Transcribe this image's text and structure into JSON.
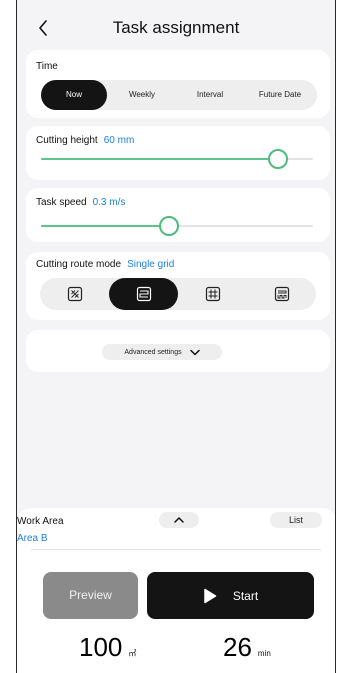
{
  "header": {
    "title": "Task assignment"
  },
  "time": {
    "label": "Time",
    "options": [
      "Now",
      "Weekly",
      "Interval",
      "Future Date"
    ],
    "selected": "Now"
  },
  "cutting_height": {
    "label": "Cutting height",
    "value": "60 mm",
    "level": 0.87
  },
  "task_speed": {
    "label": "Task speed",
    "value": "0.3 m/s",
    "level": 0.47
  },
  "route_mode": {
    "label": "Cutting route mode",
    "value": "Single grid",
    "options": [
      "random-route-icon",
      "single-grid-icon",
      "cross-grid-icon",
      "spiral-route-icon"
    ],
    "selected_index": 1
  },
  "advanced": {
    "label": "Advanced settings"
  },
  "work_area": {
    "title": "Work Area",
    "value": "Area B",
    "list_label": "List"
  },
  "actions": {
    "preview_label": "Preview",
    "start_label": "Start"
  },
  "stats": {
    "area_value": "100",
    "area_unit": "㎡",
    "time_value": "26",
    "time_unit": "min"
  },
  "colors": {
    "accent": "#1e7fe0",
    "slider": "#4cbc7c",
    "dark": "#141414"
  }
}
